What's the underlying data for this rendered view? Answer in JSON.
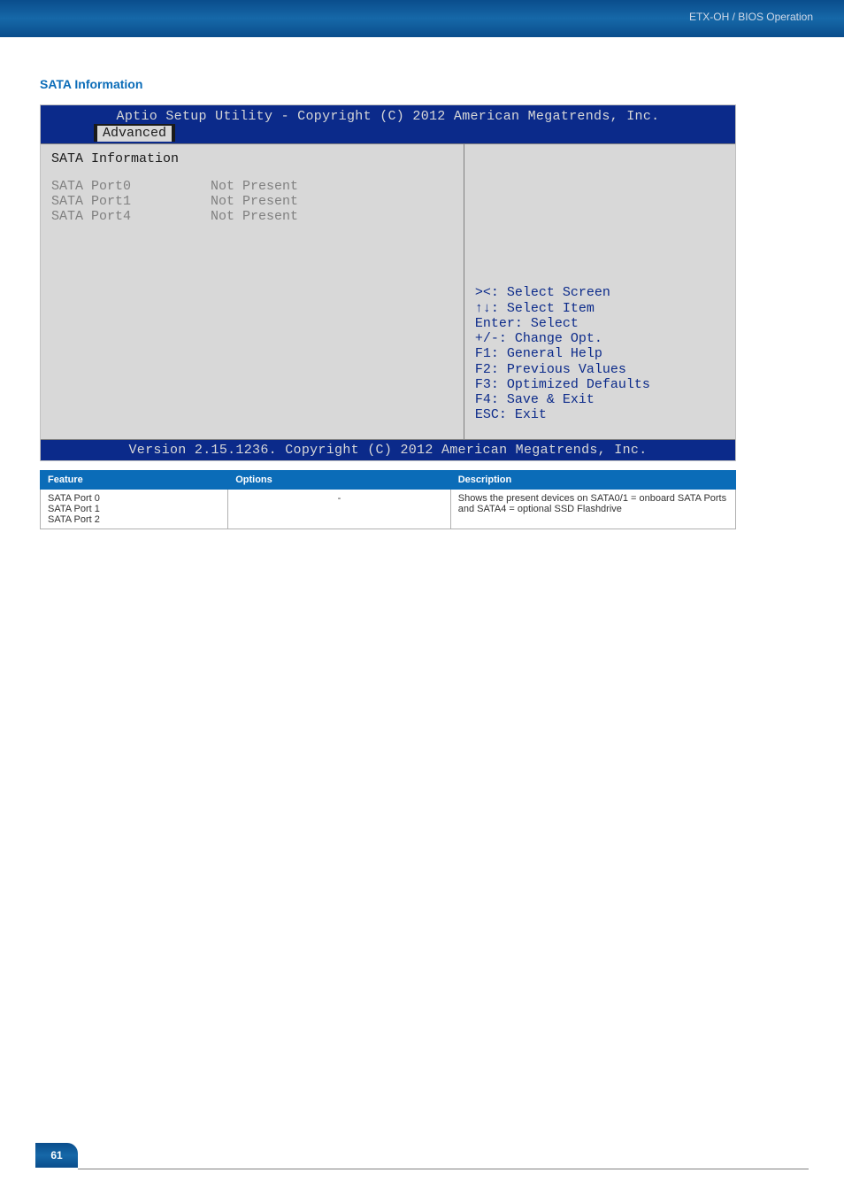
{
  "header": {
    "breadcrumb": "ETX-OH / BIOS Operation"
  },
  "section": {
    "title": "SATA Information"
  },
  "bios": {
    "title_line": "Aptio Setup Utility - Copyright (C) 2012 American Megatrends, Inc.",
    "tab": "Advanced",
    "heading": "SATA Information",
    "ports": [
      {
        "label": "SATA Port0",
        "value": "Not Present"
      },
      {
        "label": "SATA Port1",
        "value": "Not Present"
      },
      {
        "label": "SATA Port4",
        "value": "Not Present"
      }
    ],
    "help": "><: Select Screen\n↑↓: Select Item\nEnter: Select\n+/-: Change Opt.\nF1: General Help\nF2: Previous Values\nF3: Optimized Defaults\nF4: Save & Exit\nESC: Exit",
    "footer": "Version 2.15.1236. Copyright (C) 2012 American Megatrends, Inc."
  },
  "table": {
    "headers": {
      "feature": "Feature",
      "options": "Options",
      "description": "Description"
    },
    "row": {
      "feature": "SATA Port 0\nSATA Port 1\nSATA Port 2",
      "options": "-",
      "description": "Shows the present devices on SATA0/1 = onboard SATA Ports and SATA4 = optional SSD Flashdrive"
    }
  },
  "page": {
    "number": "61"
  }
}
